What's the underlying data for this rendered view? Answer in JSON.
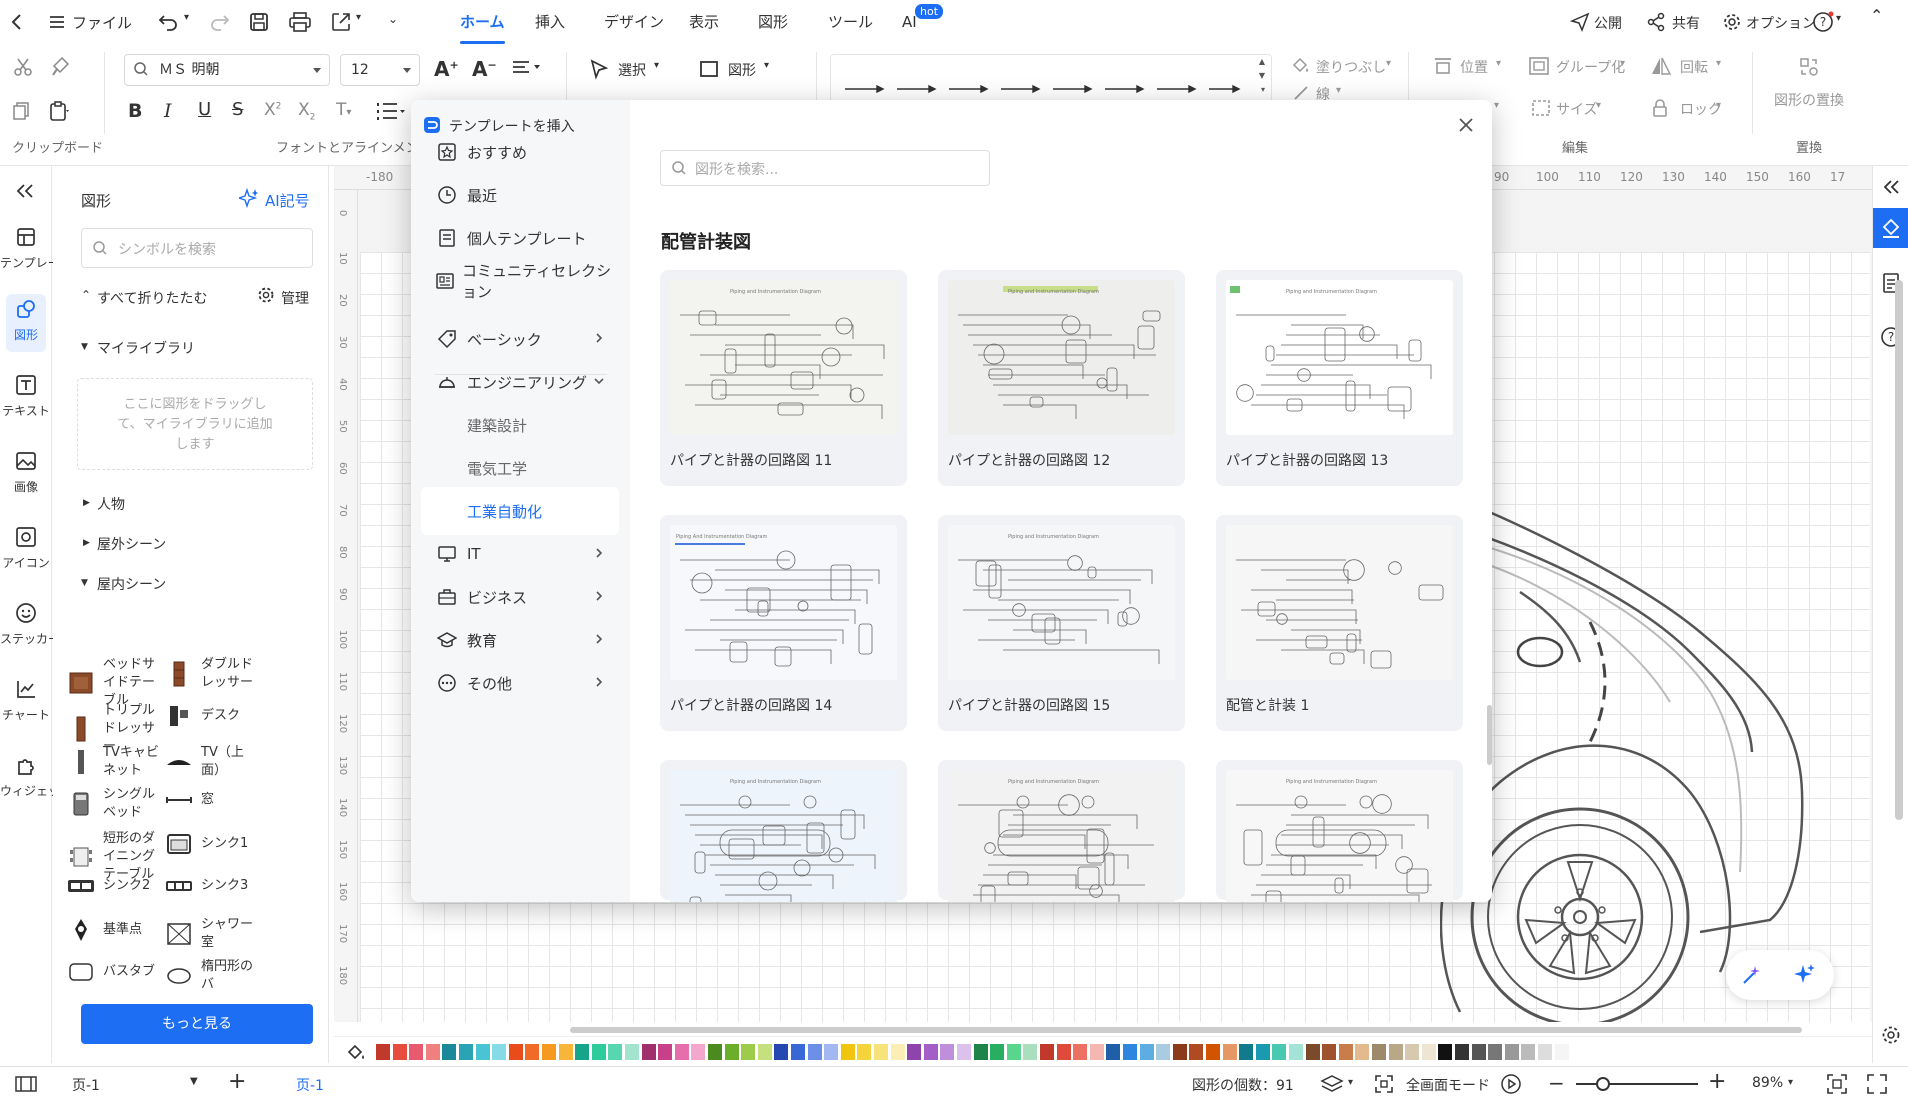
{
  "menu": {
    "file": "ファイル",
    "tabs": [
      "ホーム",
      "挿入",
      "デザイン",
      "表示",
      "図形",
      "ツール",
      "AI"
    ],
    "ai_badge": "hot",
    "publish": "公開",
    "share": "共有",
    "options": "オプション"
  },
  "ribbon": {
    "font_name": "ＭＳ 明朝",
    "font_size": "12",
    "select_label": "選択",
    "shape_label": "図形",
    "fill_label": "塗りつぶし",
    "line_label": "線",
    "position_label": "位置",
    "group_label": "グループ化",
    "rotate_label": "回転",
    "size_label": "サイズ",
    "lock_label": "ロック",
    "replace_shape_label": "図形の置換",
    "groups": {
      "clipboard": "クリップボード",
      "font_align": "フォントとアラインメント",
      "edit": "編集",
      "replace": "置換"
    }
  },
  "rail": [
    {
      "label": "テンプレート",
      "icon": "template-icon"
    },
    {
      "label": "図形",
      "icon": "shapes-icon"
    },
    {
      "label": "テキスト",
      "icon": "text-icon"
    },
    {
      "label": "画像",
      "icon": "image-icon"
    },
    {
      "label": "アイコン",
      "icon": "icon-icon"
    },
    {
      "label": "ステッカー",
      "icon": "sticker-icon"
    },
    {
      "label": "チャート",
      "icon": "chart-icon"
    },
    {
      "label": "ウィジェット",
      "icon": "widget-icon"
    }
  ],
  "shapes_panel": {
    "title": "図形",
    "ai_symbol": "AI記号",
    "search_placeholder": "シンボルを検索",
    "collapse_all": "すべて折りたたむ",
    "manage": "管理",
    "my_library": "マイライブラリ",
    "drop_hint": "ここに図形をドラッグして、マイライブラリに追加します",
    "sections": [
      "人物",
      "屋外シーン",
      "屋内シーン"
    ],
    "items": [
      "ベッドサイドテーブル",
      "ダブルドレッサー",
      "トリプルドレッサー",
      "デスク",
      "TVキャビネット",
      "TV（上面）",
      "シングルベッド",
      "窓",
      "短形のダイニングテーブル",
      "シンク1",
      "シンク2",
      "シンク3",
      "基準点",
      "シャワー室",
      "バスタブ",
      "楕円形のバ"
    ],
    "more_button": "もっと見る"
  },
  "ruler": {
    "top": [
      "-180",
      "90",
      "100",
      "110",
      "120",
      "130",
      "140",
      "150",
      "160",
      "17"
    ],
    "left": [
      "0",
      "10",
      "20",
      "30",
      "40",
      "50",
      "60",
      "70",
      "80",
      "90",
      "100",
      "110",
      "120",
      "130",
      "140",
      "150",
      "160",
      "170",
      "180"
    ]
  },
  "dialog": {
    "title": "テンプレートを挿入",
    "search_placeholder": "図形を検索...",
    "section_title": "配管計装図",
    "categories": [
      {
        "label": "おすすめ",
        "icon": "star-icon"
      },
      {
        "label": "最近",
        "icon": "clock-icon"
      },
      {
        "label": "個人テンプレート",
        "icon": "document-icon"
      },
      {
        "label": "コミュニティセレクション",
        "icon": "community-icon"
      },
      {
        "label": "ベーシック",
        "icon": "tag-icon"
      },
      {
        "label": "エンジニアリング",
        "icon": "engineering-icon"
      },
      {
        "label": "建築設計",
        "icon": ""
      },
      {
        "label": "電気工学",
        "icon": ""
      },
      {
        "label": "工業自動化",
        "icon": ""
      },
      {
        "label": "IT",
        "icon": "it-icon"
      },
      {
        "label": "ビジネス",
        "icon": "business-icon"
      },
      {
        "label": "教育",
        "icon": "education-icon"
      },
      {
        "label": "その他",
        "icon": "more-icon"
      }
    ],
    "templates": [
      "パイプと計器の回路図 11",
      "パイプと計器の回路図 12",
      "パイプと計器の回路図 13",
      "パイプと計器の回路図 14",
      "パイプと計器の回路図 15",
      "配管と計装 1",
      "",
      "",
      ""
    ],
    "thumb_titles": [
      "Piping and Instrumentation Diagram",
      "Piping and Instrumentation Diagram",
      "Piping and Instrumentation Diagram",
      "Piping And Instrumentation Diagram",
      "Piping and Instrumentation Diagram",
      "",
      "Piping and Instrumentation Diagram",
      "Piping and Instrumentation Diagram",
      "Piping and Instrumentation Diagram"
    ]
  },
  "status": {
    "page_select": "页-1",
    "page_tab": "页-1",
    "shape_count": "図形の個数：91",
    "fullscreen": "全画面モード",
    "zoom": "89%"
  },
  "colors": {
    "accent": "#1e6ef4",
    "swatches": [
      "#c0392b",
      "#e74c3c",
      "#e85a70",
      "#f08080",
      "#1a8a9a",
      "#2aa4b5",
      "#48c4d4",
      "#86dbe6",
      "#e84c1a",
      "#f06a28",
      "#f59a1e",
      "#f7b63a",
      "#17a589",
      "#2ecc9a",
      "#58d6b0",
      "#a3e4cf",
      "#a12f6b",
      "#c83f8a",
      "#e76eac",
      "#f1a8cc",
      "#4a8a1e",
      "#6aae2a",
      "#9ccc4a",
      "#c6e07e",
      "#2548b0",
      "#3867d6",
      "#6c8fe8",
      "#a3b8f3",
      "#f1c40f",
      "#f5d33a",
      "#f8e27a",
      "#fbefb5",
      "#8e44ad",
      "#a55ec8",
      "#c08fdc",
      "#dcc1ec",
      "#1e8449",
      "#27ae60",
      "#58d68d",
      "#a9dfbf",
      "#c0392b",
      "#e04a3a",
      "#ec7063",
      "#f5b7b1",
      "#1f5fa8",
      "#2e86de",
      "#5dade2",
      "#a9cce3",
      "#8b3a1a",
      "#b04a22",
      "#d35400",
      "#e59866",
      "#117a8b",
      "#1a9ab0",
      "#48c9b0",
      "#a3e4d7",
      "#7b4a2a",
      "#a0522d",
      "#c97e4a",
      "#e3b98e",
      "#9c8a6a",
      "#b8a888",
      "#d6c9ad",
      "#eee6d2",
      "#111111",
      "#333333",
      "#555555",
      "#777777",
      "#999999",
      "#bbbbbb",
      "#dddddd",
      "#f5f5f5"
    ]
  }
}
